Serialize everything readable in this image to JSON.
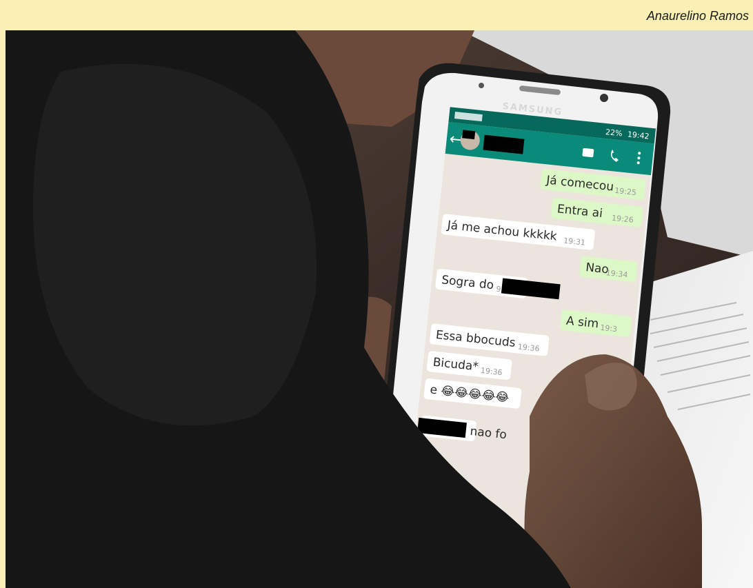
{
  "credit": "Anaurelino Ramos",
  "phone": {
    "brand": "SAMSUNG",
    "status": {
      "battery": "22%",
      "time": "19:42"
    }
  },
  "chat": {
    "messages": [
      {
        "side": "out",
        "text": "Já comecou",
        "time": "19:25"
      },
      {
        "side": "out",
        "text": "Entra ai",
        "time": "19:26"
      },
      {
        "side": "in",
        "text": "Já me achou kkkkk",
        "time": "19:31"
      },
      {
        "side": "out",
        "text": "Nao",
        "time": "19:34"
      },
      {
        "side": "in",
        "text": "Sogra do",
        "time": "9:36"
      },
      {
        "side": "out",
        "text": "A sim",
        "time": "19:3"
      },
      {
        "side": "in",
        "text": "Essa bbocuds",
        "time": "19:36"
      },
      {
        "side": "in",
        "text": "Bicuda*",
        "time": "19:36"
      },
      {
        "side": "in",
        "text": "e 😂😂😂😂😂",
        "time": ""
      },
      {
        "side": "in",
        "text": "nao fo",
        "time": ""
      }
    ]
  },
  "colors": {
    "header_teal": "#0a8a78",
    "status_teal": "#07695b",
    "chat_bg": "#ece5dd",
    "bubble_out": "#dcf8c6",
    "bubble_in": "#ffffff"
  }
}
